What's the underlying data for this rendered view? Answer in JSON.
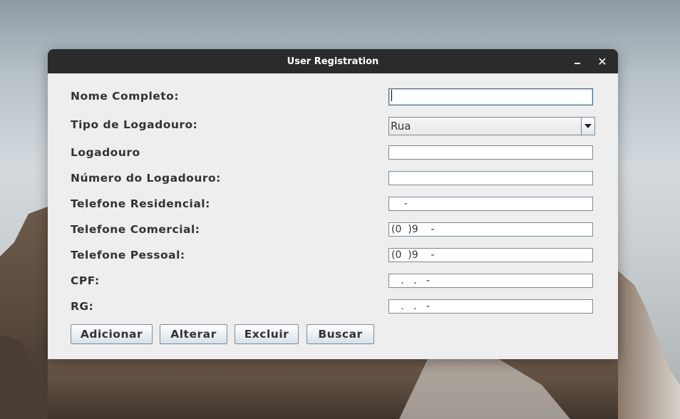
{
  "window": {
    "title": "User Registration"
  },
  "form": {
    "nome_completo": {
      "label": "Nome Completo:",
      "value": ""
    },
    "tipo_logadouro": {
      "label": "Tipo de Logadouro:",
      "selected": "Rua"
    },
    "logadouro": {
      "label": "Logadouro",
      "value": ""
    },
    "numero_logadouro": {
      "label": "Número do Logadouro:",
      "value": ""
    },
    "telefone_residencial": {
      "label": "Telefone Residencial:",
      "value": "    -"
    },
    "telefone_comercial": {
      "label": "Telefone Comercial:",
      "value": "(0  )9    -"
    },
    "telefone_pessoal": {
      "label": "Telefone Pessoal:",
      "value": "(0  )9    -"
    },
    "cpf": {
      "label": "CPF:",
      "value": "   .   .   -"
    },
    "rg": {
      "label": "RG:",
      "value": "   .   .   -"
    }
  },
  "buttons": {
    "adicionar": "Adicionar",
    "alterar": "Alterar",
    "excluir": "Excluir",
    "buscar": "Buscar"
  },
  "icons": {
    "minimize": "minimize-icon",
    "close": "close-icon",
    "dropdown": "chevron-down-icon"
  }
}
